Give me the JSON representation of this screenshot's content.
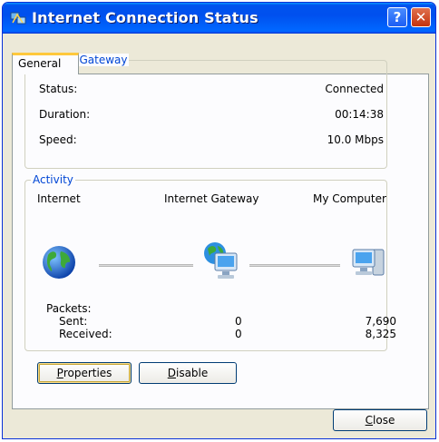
{
  "window": {
    "title": "Internet Connection Status"
  },
  "titlebar_buttons": {
    "help": "?",
    "close": "✕"
  },
  "tabs": [
    {
      "label": "General"
    }
  ],
  "internet_gateway": {
    "title": "Internet Gateway",
    "rows": [
      {
        "label": "Status:",
        "value": "Connected"
      },
      {
        "label": "Duration:",
        "value": "00:14:38"
      },
      {
        "label": "Speed:",
        "value": "10.0 Mbps"
      }
    ]
  },
  "activity": {
    "title": "Activity",
    "nodes": [
      "Internet",
      "Internet Gateway",
      "My Computer"
    ],
    "packets_label": "Packets:",
    "sent_label": "Sent:",
    "received_label": "Received:",
    "sent_gateway": "0",
    "received_gateway": "0",
    "sent_computer": "7,690",
    "received_computer": "8,325"
  },
  "buttons": {
    "properties_first": "P",
    "properties_rest": "roperties",
    "disable_first": "D",
    "disable_rest": "isable",
    "close_first": "C",
    "close_rest": "lose"
  },
  "icons": {
    "title": "network-connection-icon",
    "internet": "globe-icon",
    "gateway": "gateway-computer-icon",
    "computer": "computer-icon"
  },
  "colors": {
    "titlebar": "#0054e3",
    "group_title": "#0046d5",
    "close_button": "#c5320d"
  }
}
